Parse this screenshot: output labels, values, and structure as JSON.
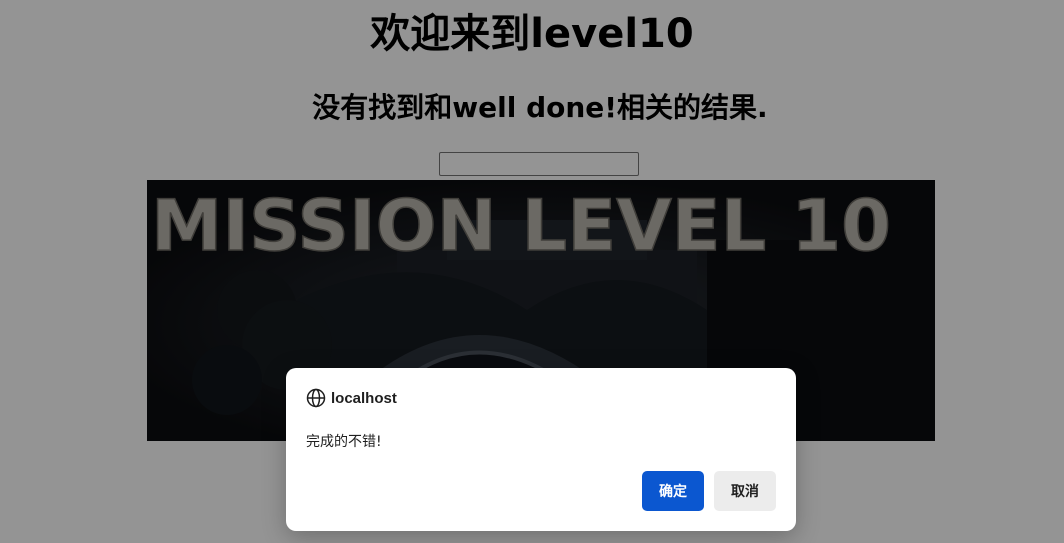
{
  "page": {
    "title": "欢迎来到level10",
    "result_heading": "没有找到和well done!相关的结果.",
    "search_input": {
      "value": "",
      "placeholder": ""
    },
    "banner": {
      "text": "MISSION LEVEL 10",
      "image_description_icon": "haunted-gate-image"
    }
  },
  "dialog": {
    "icon": "globe-icon",
    "origin": "localhost",
    "message": "完成的不错!",
    "ok_label": "确定",
    "cancel_label": "取消"
  },
  "colors": {
    "overlay": "#6b6b6b",
    "primary_button": "#0b57d0",
    "secondary_button": "#ececec",
    "banner_bg": "#0f0f13",
    "banner_text": "#b9b6ad"
  }
}
